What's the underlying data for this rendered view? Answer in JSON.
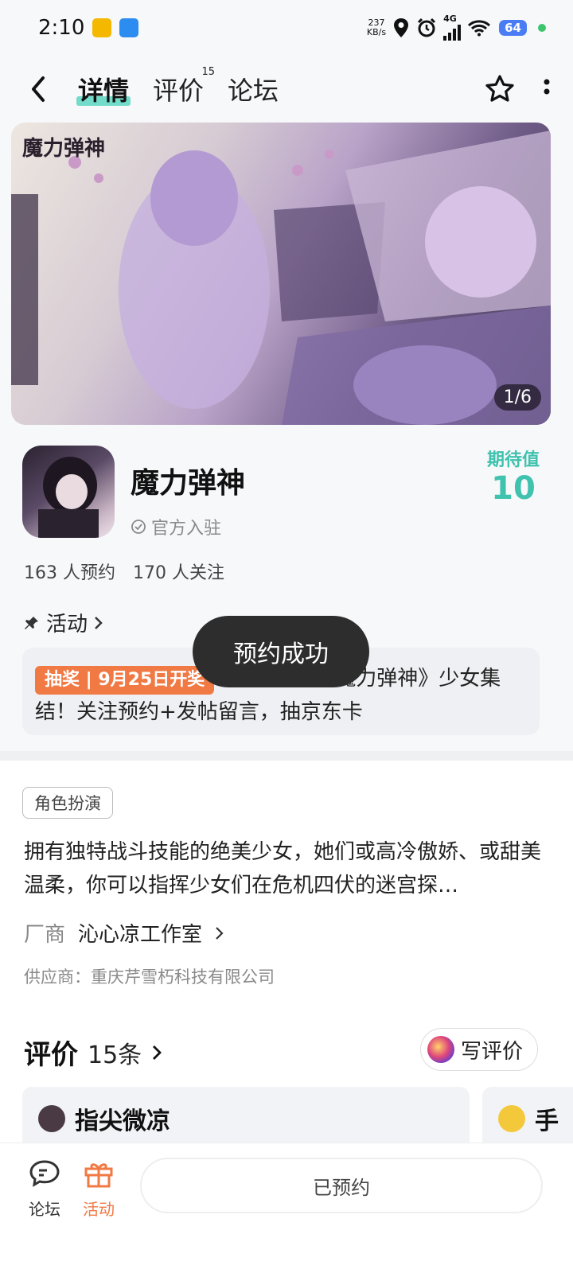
{
  "status_bar": {
    "time": "2:10",
    "net_speed_value": "237",
    "net_speed_unit": "KB/s",
    "network": "4G",
    "battery": "64"
  },
  "nav": {
    "tabs": [
      {
        "label": "详情",
        "active": true
      },
      {
        "label": "评价",
        "badge": "15"
      },
      {
        "label": "论坛"
      }
    ]
  },
  "banner": {
    "logo_text": "魔力弹神",
    "counter": "1/6"
  },
  "game": {
    "title": "魔力弹神",
    "official": "官方入驻",
    "expect_label": "期待值",
    "expect_value": "10",
    "reservations": "163 人预约",
    "followers": "170 人关注"
  },
  "activity": {
    "heading": "活动",
    "tag": "抽奖 | 9月25日开奖",
    "text_hidden_part": "《魔力弹神》少女集",
    "text_visible_line1": "魔力弹神》少女集",
    "text_line2": "结！关注预约+发帖留言，抽京东卡"
  },
  "toast": "预约成功",
  "details": {
    "genre": "角色扮演",
    "description": "拥有独特战斗技能的绝美少女，她们或高冷傲娇、或甜美温柔，你可以指挥少女们在危机四伏的迷宫探…",
    "maker_label": "厂商",
    "maker_name": "沁心凉工作室",
    "supplier": "供应商：重庆芹雪朽科技有限公司"
  },
  "reviews": {
    "title": "评价",
    "count": "15条",
    "write_label": "写评价",
    "cards": [
      {
        "user": "指尖微凉"
      },
      {
        "user": "手"
      }
    ]
  },
  "bottom": {
    "forum_label": "论坛",
    "activity_label": "活动",
    "reserved_label": "已预约"
  },
  "colors": {
    "accent_teal": "#3fc2ae",
    "accent_orange": "#f07944",
    "toast_bg": "#2d2d2d"
  }
}
